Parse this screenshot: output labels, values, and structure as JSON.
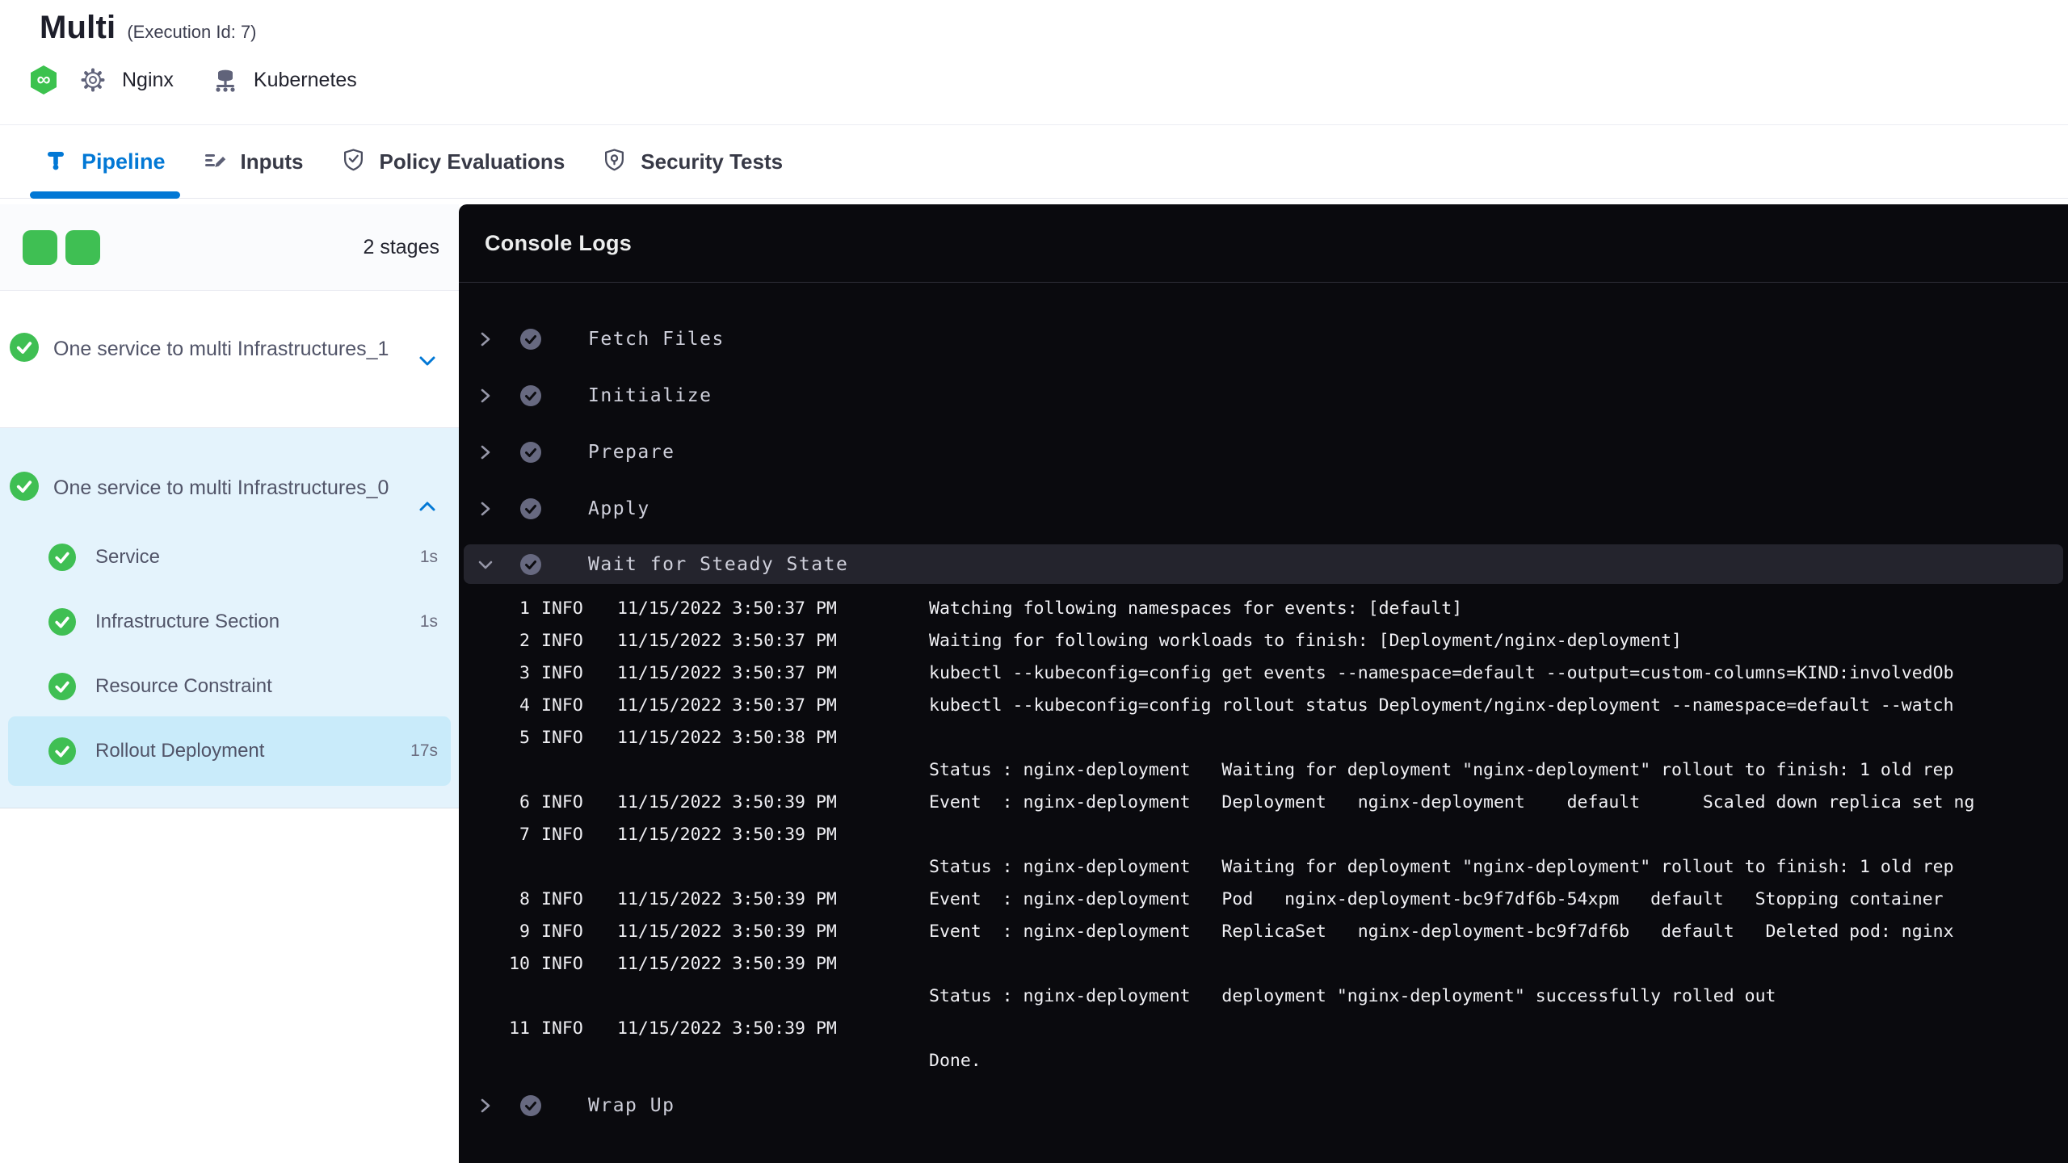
{
  "header": {
    "title": "Multi",
    "execution_id": "(Execution Id: 7)",
    "service_label": "Nginx",
    "infra_label": "Kubernetes"
  },
  "tabs": [
    {
      "label": "Pipeline",
      "active": true
    },
    {
      "label": "Inputs",
      "active": false
    },
    {
      "label": "Policy Evaluations",
      "active": false
    },
    {
      "label": "Security Tests",
      "active": false
    }
  ],
  "sidebar": {
    "stage_count": "2 stages",
    "stages": [
      {
        "name": "One service to multi Infrastructures_1",
        "status": "success",
        "expanded": false
      },
      {
        "name": "One service to multi Infrastructures_0",
        "status": "success",
        "expanded": true,
        "steps": [
          {
            "name": "Service",
            "duration": "1s",
            "status": "success",
            "selected": false
          },
          {
            "name": "Infrastructure Section",
            "duration": "1s",
            "status": "success",
            "selected": false
          },
          {
            "name": "Resource Constraint",
            "duration": "",
            "status": "success",
            "selected": false
          },
          {
            "name": "Rollout Deployment",
            "duration": "17s",
            "status": "success",
            "selected": true
          }
        ]
      }
    ]
  },
  "console": {
    "title": "Console Logs",
    "sections": [
      {
        "name": "Fetch Files",
        "state": "collapsed",
        "status": "success"
      },
      {
        "name": "Initialize",
        "state": "collapsed",
        "status": "success"
      },
      {
        "name": "Prepare",
        "state": "collapsed",
        "status": "success"
      },
      {
        "name": "Apply",
        "state": "collapsed",
        "status": "success"
      },
      {
        "name": "Wait for Steady State",
        "state": "expanded",
        "status": "success"
      },
      {
        "name": "Wrap Up",
        "state": "collapsed",
        "status": "success"
      }
    ],
    "log_lines": [
      {
        "num": "1",
        "level": "INFO",
        "time": "11/15/2022 3:50:37 PM",
        "message": "Watching following namespaces for events: [default]"
      },
      {
        "num": "2",
        "level": "INFO",
        "time": "11/15/2022 3:50:37 PM",
        "message": "Waiting for following workloads to finish: [Deployment/nginx-deployment]"
      },
      {
        "num": "3",
        "level": "INFO",
        "time": "11/15/2022 3:50:37 PM",
        "message": "kubectl --kubeconfig=config get events --namespace=default --output=custom-columns=KIND:involvedOb"
      },
      {
        "num": "4",
        "level": "INFO",
        "time": "11/15/2022 3:50:37 PM",
        "message": "kubectl --kubeconfig=config rollout status Deployment/nginx-deployment --namespace=default --watch"
      },
      {
        "num": "5",
        "level": "INFO",
        "time": "11/15/2022 3:50:38 PM",
        "message": "",
        "continuation": "Status : nginx-deployment   Waiting for deployment \"nginx-deployment\" rollout to finish: 1 old rep"
      },
      {
        "num": "6",
        "level": "INFO",
        "time": "11/15/2022 3:50:39 PM",
        "message": "Event  : nginx-deployment   Deployment   nginx-deployment    default      Scaled down replica set ng"
      },
      {
        "num": "7",
        "level": "INFO",
        "time": "11/15/2022 3:50:39 PM",
        "message": "",
        "continuation": "Status : nginx-deployment   Waiting for deployment \"nginx-deployment\" rollout to finish: 1 old rep"
      },
      {
        "num": "8",
        "level": "INFO",
        "time": "11/15/2022 3:50:39 PM",
        "message": "Event  : nginx-deployment   Pod   nginx-deployment-bc9f7df6b-54xpm   default   Stopping container"
      },
      {
        "num": "9",
        "level": "INFO",
        "time": "11/15/2022 3:50:39 PM",
        "message": "Event  : nginx-deployment   ReplicaSet   nginx-deployment-bc9f7df6b   default   Deleted pod: nginx"
      },
      {
        "num": "10",
        "level": "INFO",
        "time": "11/15/2022 3:50:39 PM",
        "message": "",
        "continuation": "Status : nginx-deployment   deployment \"nginx-deployment\" successfully rolled out"
      },
      {
        "num": "11",
        "level": "INFO",
        "time": "11/15/2022 3:50:39 PM",
        "message": "",
        "continuation": "Done."
      }
    ]
  },
  "icons": {
    "harness_cd": "∞ in green hexagon",
    "gear": "settings gear outline",
    "kubernetes": "server / infrastructure glyph",
    "success_check": "white check in green circle",
    "console_check": "dark check in gray circle",
    "chevron": "expand / collapse arrow"
  },
  "colors": {
    "accent_blue": "#0278d5",
    "success_green": "#3fbf53",
    "selected_stage_bg": "#e4f3fc",
    "selected_step_bg": "#c9ebfa",
    "console_bg": "#0a0a0e",
    "console_highlight": "#24242d"
  }
}
